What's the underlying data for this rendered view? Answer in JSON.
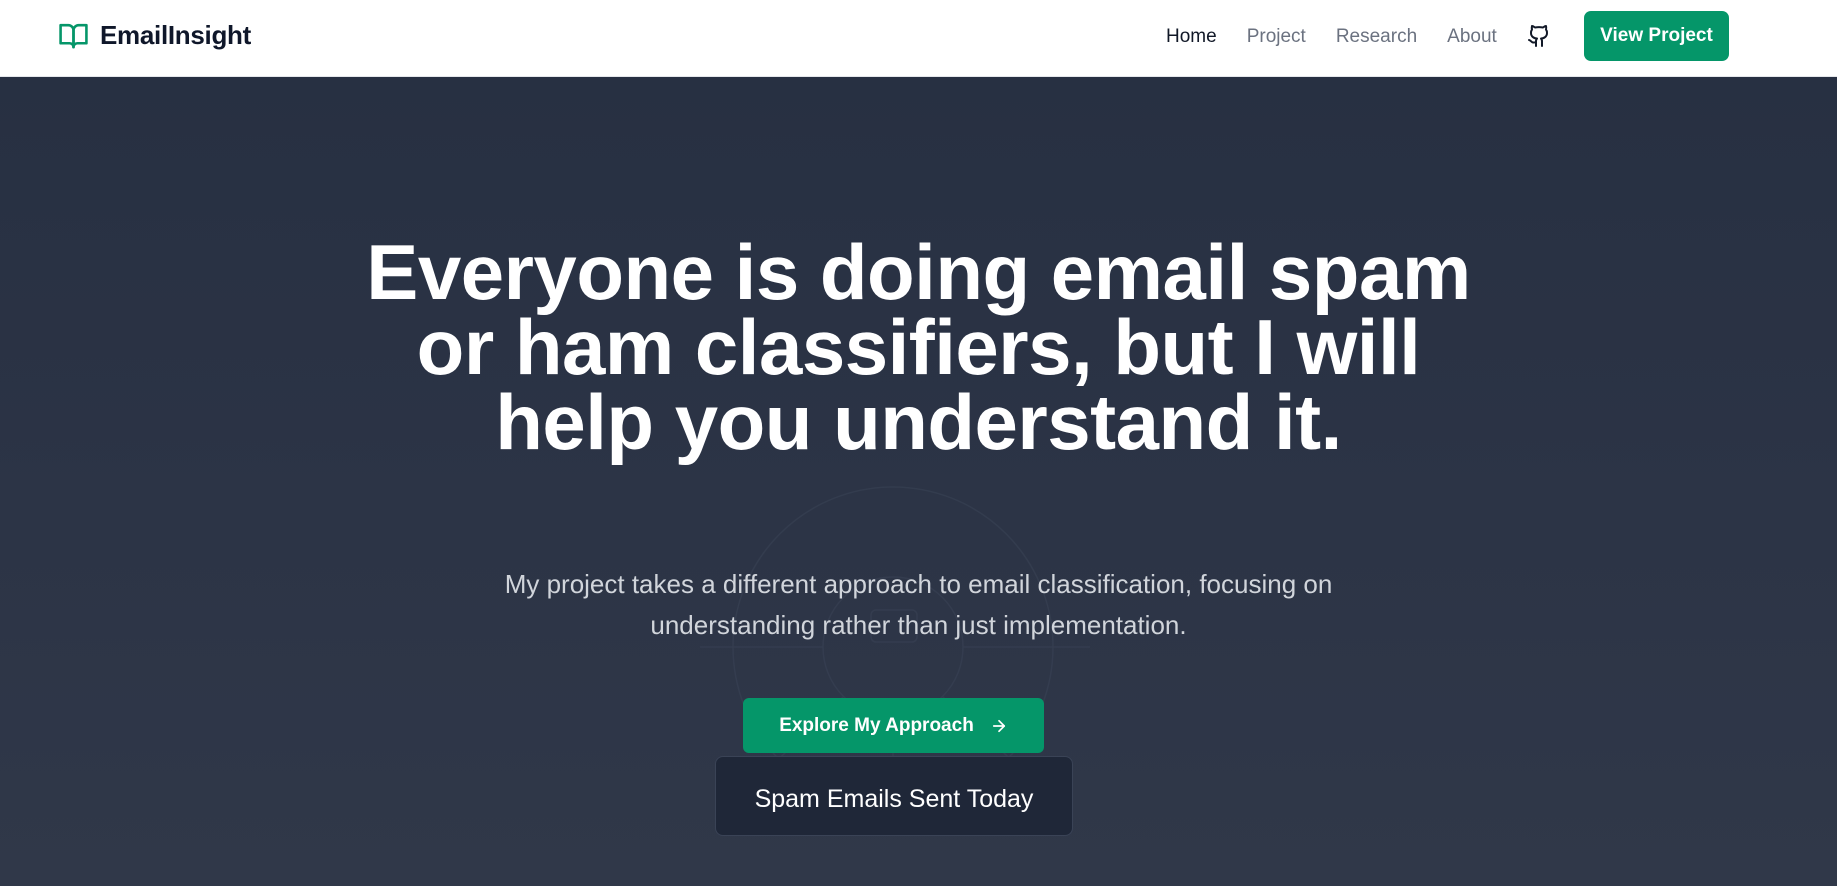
{
  "header": {
    "brand_name": "EmailInsight",
    "nav_items": [
      {
        "label": "Home",
        "active": true
      },
      {
        "label": "Project",
        "active": false
      },
      {
        "label": "Research",
        "active": false
      },
      {
        "label": "About",
        "active": false
      }
    ],
    "github_icon": "github-icon",
    "cta_label": "View Project"
  },
  "hero": {
    "title": "Everyone is doing email spam or ham classifiers, but I will help you understand it.",
    "subtitle": "My project takes a different approach to email classification, focusing on understanding rather than just implementation.",
    "button_label": "Explore My Approach",
    "button_icon": "arrow-right-icon"
  },
  "stat_card": {
    "title": "Spam Emails Sent Today"
  },
  "colors": {
    "accent": "#059669",
    "header_bg": "#ffffff",
    "hero_bg": "#2a3142",
    "card_bg": "#1f2738"
  }
}
